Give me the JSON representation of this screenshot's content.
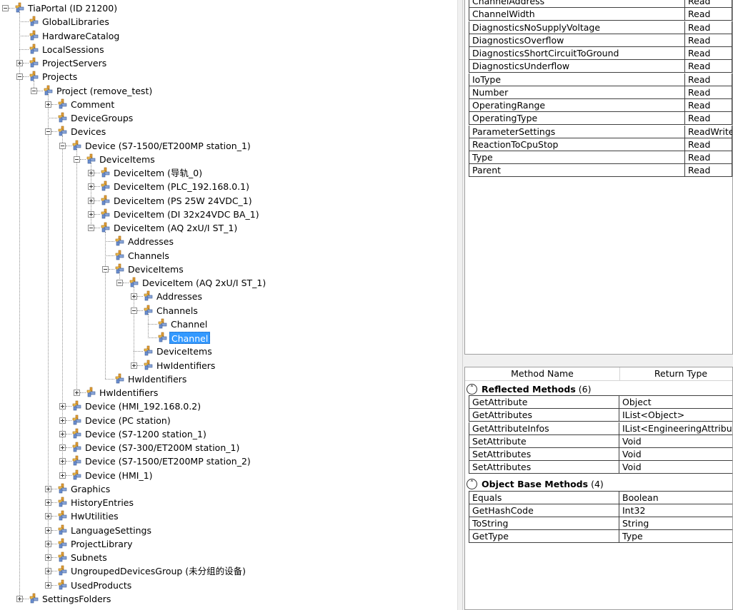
{
  "tree": {
    "nodes": [
      {
        "label": "TiaPortal (ID 21200)",
        "depth": 0,
        "toggle": "minus"
      },
      {
        "label": "GlobalLibraries",
        "depth": 1,
        "toggle": "none"
      },
      {
        "label": "HardwareCatalog",
        "depth": 1,
        "toggle": "none"
      },
      {
        "label": "LocalSessions",
        "depth": 1,
        "toggle": "none"
      },
      {
        "label": "ProjectServers",
        "depth": 1,
        "toggle": "plus"
      },
      {
        "label": "Projects",
        "depth": 1,
        "toggle": "minus"
      },
      {
        "label": "Project (remove_test)",
        "depth": 2,
        "toggle": "minus"
      },
      {
        "label": "Comment",
        "depth": 3,
        "toggle": "plus"
      },
      {
        "label": "DeviceGroups",
        "depth": 3,
        "toggle": "none"
      },
      {
        "label": "Devices",
        "depth": 3,
        "toggle": "minus"
      },
      {
        "label": "Device (S7-1500/ET200MP station_1)",
        "depth": 4,
        "toggle": "minus"
      },
      {
        "label": "DeviceItems",
        "depth": 5,
        "toggle": "minus"
      },
      {
        "label": "DeviceItem (导轨_0)",
        "depth": 6,
        "toggle": "plus"
      },
      {
        "label": "DeviceItem (PLC_192.168.0.1)",
        "depth": 6,
        "toggle": "plus"
      },
      {
        "label": "DeviceItem (PS 25W 24VDC_1)",
        "depth": 6,
        "toggle": "plus"
      },
      {
        "label": "DeviceItem (DI 32x24VDC BA_1)",
        "depth": 6,
        "toggle": "plus"
      },
      {
        "label": "DeviceItem (AQ 2xU/I ST_1)",
        "depth": 6,
        "toggle": "minus"
      },
      {
        "label": "Addresses",
        "depth": 7,
        "toggle": "none"
      },
      {
        "label": "Channels",
        "depth": 7,
        "toggle": "none"
      },
      {
        "label": "DeviceItems",
        "depth": 7,
        "toggle": "minus"
      },
      {
        "label": "DeviceItem (AQ 2xU/I ST_1)",
        "depth": 8,
        "toggle": "minus"
      },
      {
        "label": "Addresses",
        "depth": 9,
        "toggle": "plus"
      },
      {
        "label": "Channels",
        "depth": 9,
        "toggle": "minus"
      },
      {
        "label": "Channel",
        "depth": 10,
        "toggle": "none"
      },
      {
        "label": "Channel",
        "depth": 10,
        "toggle": "none",
        "selected": true
      },
      {
        "label": "DeviceItems",
        "depth": 9,
        "toggle": "none"
      },
      {
        "label": "HwIdentifiers",
        "depth": 9,
        "toggle": "plus"
      },
      {
        "label": "HwIdentifiers",
        "depth": 7,
        "toggle": "none"
      },
      {
        "label": "HwIdentifiers",
        "depth": 5,
        "toggle": "plus"
      },
      {
        "label": "Device (HMI_192.168.0.2)",
        "depth": 4,
        "toggle": "plus"
      },
      {
        "label": "Device (PC station)",
        "depth": 4,
        "toggle": "plus"
      },
      {
        "label": "Device (S7-1200 station_1)",
        "depth": 4,
        "toggle": "plus"
      },
      {
        "label": "Device (S7-300/ET200M station_1)",
        "depth": 4,
        "toggle": "plus"
      },
      {
        "label": "Device (S7-1500/ET200MP station_2)",
        "depth": 4,
        "toggle": "plus"
      },
      {
        "label": "Device (HMI_1)",
        "depth": 4,
        "toggle": "plus"
      },
      {
        "label": "Graphics",
        "depth": 3,
        "toggle": "plus"
      },
      {
        "label": "HistoryEntries",
        "depth": 3,
        "toggle": "plus"
      },
      {
        "label": "HwUtilities",
        "depth": 3,
        "toggle": "plus"
      },
      {
        "label": "LanguageSettings",
        "depth": 3,
        "toggle": "plus"
      },
      {
        "label": "ProjectLibrary",
        "depth": 3,
        "toggle": "plus"
      },
      {
        "label": "Subnets",
        "depth": 3,
        "toggle": "plus"
      },
      {
        "label": "UngroupedDevicesGroup (未分组的设备)",
        "depth": 3,
        "toggle": "plus"
      },
      {
        "label": "UsedProducts",
        "depth": 3,
        "toggle": "plus"
      },
      {
        "label": "SettingsFolders",
        "depth": 1,
        "toggle": "plus"
      }
    ]
  },
  "properties": {
    "rows": [
      {
        "name": "ChannelAddress",
        "access": "Read"
      },
      {
        "name": "ChannelWidth",
        "access": "Read"
      },
      {
        "name": "DiagnosticsNoSupplyVoltage",
        "access": "Read"
      },
      {
        "name": "DiagnosticsOverflow",
        "access": "Read"
      },
      {
        "name": "DiagnosticsShortCircuitToGround",
        "access": "Read"
      },
      {
        "name": "DiagnosticsUnderflow",
        "access": "Read"
      },
      {
        "name": "IoType",
        "access": "Read"
      },
      {
        "name": "Number",
        "access": "Read"
      },
      {
        "name": "OperatingRange",
        "access": "Read"
      },
      {
        "name": "OperatingType",
        "access": "Read"
      },
      {
        "name": "ParameterSettings",
        "access": "ReadWrite"
      },
      {
        "name": "ReactionToCpuStop",
        "access": "Read"
      },
      {
        "name": "Type",
        "access": "Read"
      },
      {
        "name": "Parent",
        "access": "Read"
      }
    ]
  },
  "methods": {
    "header": {
      "name": "Method Name",
      "return": "Return Type"
    },
    "groups": [
      {
        "title": "Reflected Methods",
        "count": "(6)",
        "rows": [
          {
            "name": "GetAttribute",
            "return": "Object"
          },
          {
            "name": "GetAttributes",
            "return": "IList<Object>"
          },
          {
            "name": "GetAttributeInfos",
            "return": "IList<EngineeringAttributeIn"
          },
          {
            "name": "SetAttribute",
            "return": "Void"
          },
          {
            "name": "SetAttributes",
            "return": "Void"
          },
          {
            "name": "SetAttributes",
            "return": "Void"
          }
        ]
      },
      {
        "title": "Object Base Methods",
        "count": "(4)",
        "rows": [
          {
            "name": "Equals",
            "return": "Boolean"
          },
          {
            "name": "GetHashCode",
            "return": "Int32"
          },
          {
            "name": "ToString",
            "return": "String"
          },
          {
            "name": "GetType",
            "return": "Type"
          }
        ]
      }
    ]
  },
  "colors": {
    "selection": "#3399ff",
    "panel_bg": "#f0f0f0"
  }
}
